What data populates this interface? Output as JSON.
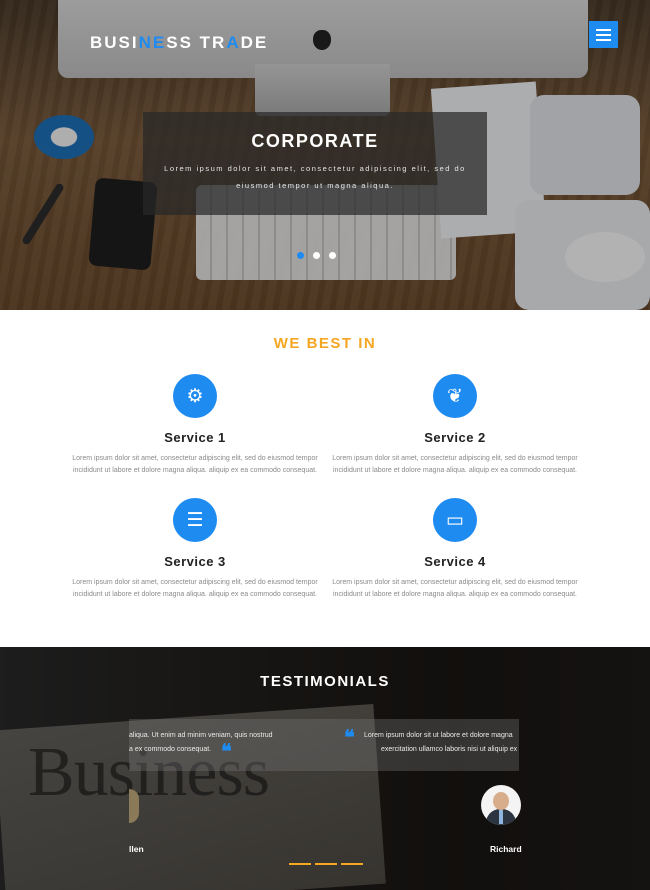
{
  "header": {
    "logo_parts": [
      "BUSI",
      "NE",
      "SS TR",
      "A",
      "DE"
    ]
  },
  "hero": {
    "title": "CORPORATE",
    "text": "Lorem ipsum dolor sit amet, consectetur adipiscing elit, sed do eiusmod tempor ut magna aliqua.",
    "slides": 3,
    "active_slide": 1
  },
  "services": {
    "title": "WE BEST IN",
    "items": [
      {
        "name": "Service 1",
        "icon": "gear-icon",
        "glyph": "⚙",
        "desc": "Lorem ipsum dolor sit amet, consectetur adipiscing elit, sed do eiusmod tempor incididunt ut labore et dolore magna aliqua. aliquip ex ea commodo consequat."
      },
      {
        "name": "Service 2",
        "icon": "leaf-icon",
        "glyph": "❦",
        "desc": "Lorem ipsum dolor sit amet, consectetur adipiscing elit, sed do eiusmod tempor incididunt ut labore et dolore magna aliqua. aliquip ex ea commodo consequat."
      },
      {
        "name": "Service 3",
        "icon": "server-icon",
        "glyph": "☰",
        "desc": "Lorem ipsum dolor sit amet, consectetur adipiscing elit, sed do eiusmod tempor incididunt ut labore et dolore magna aliqua. aliquip ex ea commodo consequat."
      },
      {
        "name": "Service 4",
        "icon": "laptop-icon",
        "glyph": "▭",
        "desc": "Lorem ipsum dolor sit amet, consectetur adipiscing elit, sed do eiusmod tempor incididunt ut labore et dolore magna aliqua. aliquip ex ea commodo consequat."
      }
    ]
  },
  "testimonials": {
    "title": "TESTIMONIALS",
    "quote_left_1": "aliqua. Ut enim ad minim veniam, quis nostrud",
    "quote_left_2": "a ex commodo consequat.",
    "quote_right_1": "Lorem ipsum dolor sit ut labore et dolore magna",
    "quote_right_2": "exercitation ullamco laboris nisi ut aliquip ex",
    "name_left": "llen",
    "name_right": "Richard"
  },
  "colors": {
    "accent": "#1e8bf1",
    "highlight": "#f5a623"
  }
}
